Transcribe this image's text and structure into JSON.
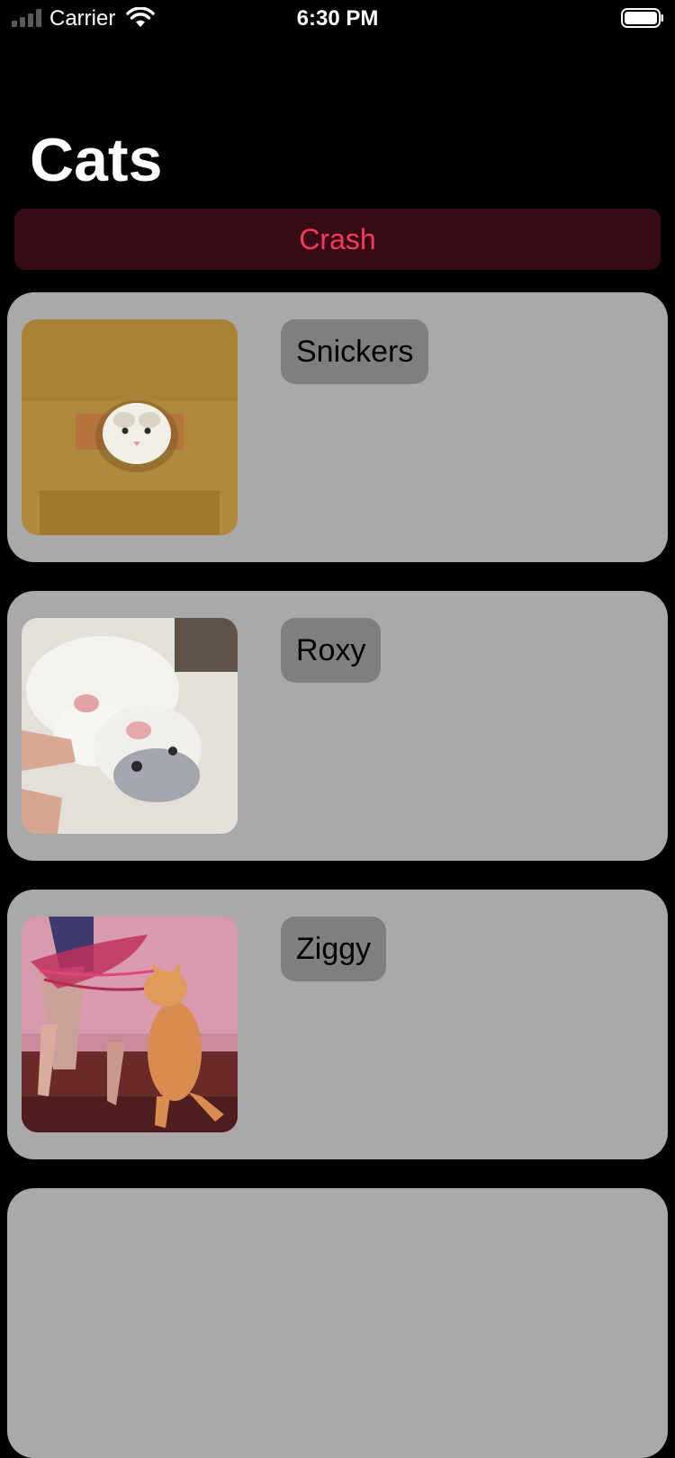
{
  "status_bar": {
    "carrier": "Carrier",
    "time": "6:30 PM",
    "icons": [
      "signal-icon",
      "wifi-icon",
      "battery-icon"
    ]
  },
  "page": {
    "title": "Cats"
  },
  "crash_button": {
    "label": "Crash"
  },
  "cats": [
    {
      "name": "Snickers",
      "photo": "cat-photo-snickers"
    },
    {
      "name": "Roxy",
      "photo": "cat-photo-roxy"
    },
    {
      "name": "Ziggy",
      "photo": "cat-photo-ziggy"
    },
    {
      "name": "",
      "photo": ""
    }
  ],
  "colors": {
    "background": "#000000",
    "card": "#a9a9a9",
    "name_badge": "#7f7f7f",
    "crash_text": "#fe375f",
    "crash_background": "#360b14"
  }
}
